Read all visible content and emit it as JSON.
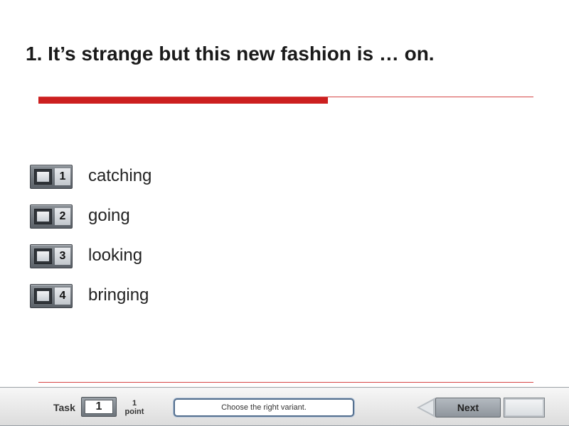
{
  "question": {
    "text": "1. It’s strange but this new fashion is … on."
  },
  "options": [
    {
      "number": "1",
      "label": "catching"
    },
    {
      "number": "2",
      "label": "going"
    },
    {
      "number": "3",
      "label": "looking"
    },
    {
      "number": "4",
      "label": "bringing"
    }
  ],
  "footer": {
    "task_label": "Task",
    "task_number": "1",
    "points_value": "1",
    "points_label": "point",
    "hint": "Choose the right variant.",
    "next_label": "Next"
  },
  "colors": {
    "accent_red": "#cc1f1f",
    "panel_gray": "#6e757c"
  }
}
